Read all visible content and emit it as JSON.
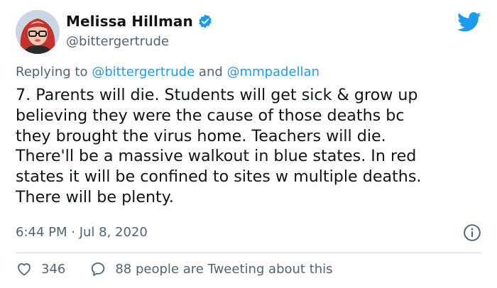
{
  "author": {
    "display_name": "Melissa Hillman",
    "handle": "@bittergertrude",
    "verified": true,
    "avatar_icon": "avatar-photo"
  },
  "reply_to": {
    "prefix": "Replying to",
    "mention_1": "@bittergertrude",
    "conjunction": "and",
    "mention_2": "@mmpadellan"
  },
  "tweet": {
    "text": "7. Parents will die. Students will get sick & grow up\nbelieving they were the cause of those deaths bc\nthey brought the virus home. Teachers will die.\nThere'll be a massive walkout in blue states. In red\nstates it will be confined to sites w multiple deaths.\nThere will be plenty.",
    "timestamp": "6:44 PM · Jul 8, 2020"
  },
  "stats": {
    "likes": "346",
    "reply_text": "88 people are Tweeting about this"
  },
  "icons": {
    "logo": "twitter-bird-icon",
    "info": "info-icon",
    "like": "heart-icon",
    "reply": "speech-bubble-icon",
    "verified": "verified-badge-icon"
  },
  "colors": {
    "accent": "#1d9bf0",
    "text": "#0f1419",
    "muted": "#536471",
    "divider": "#cfd9de"
  }
}
